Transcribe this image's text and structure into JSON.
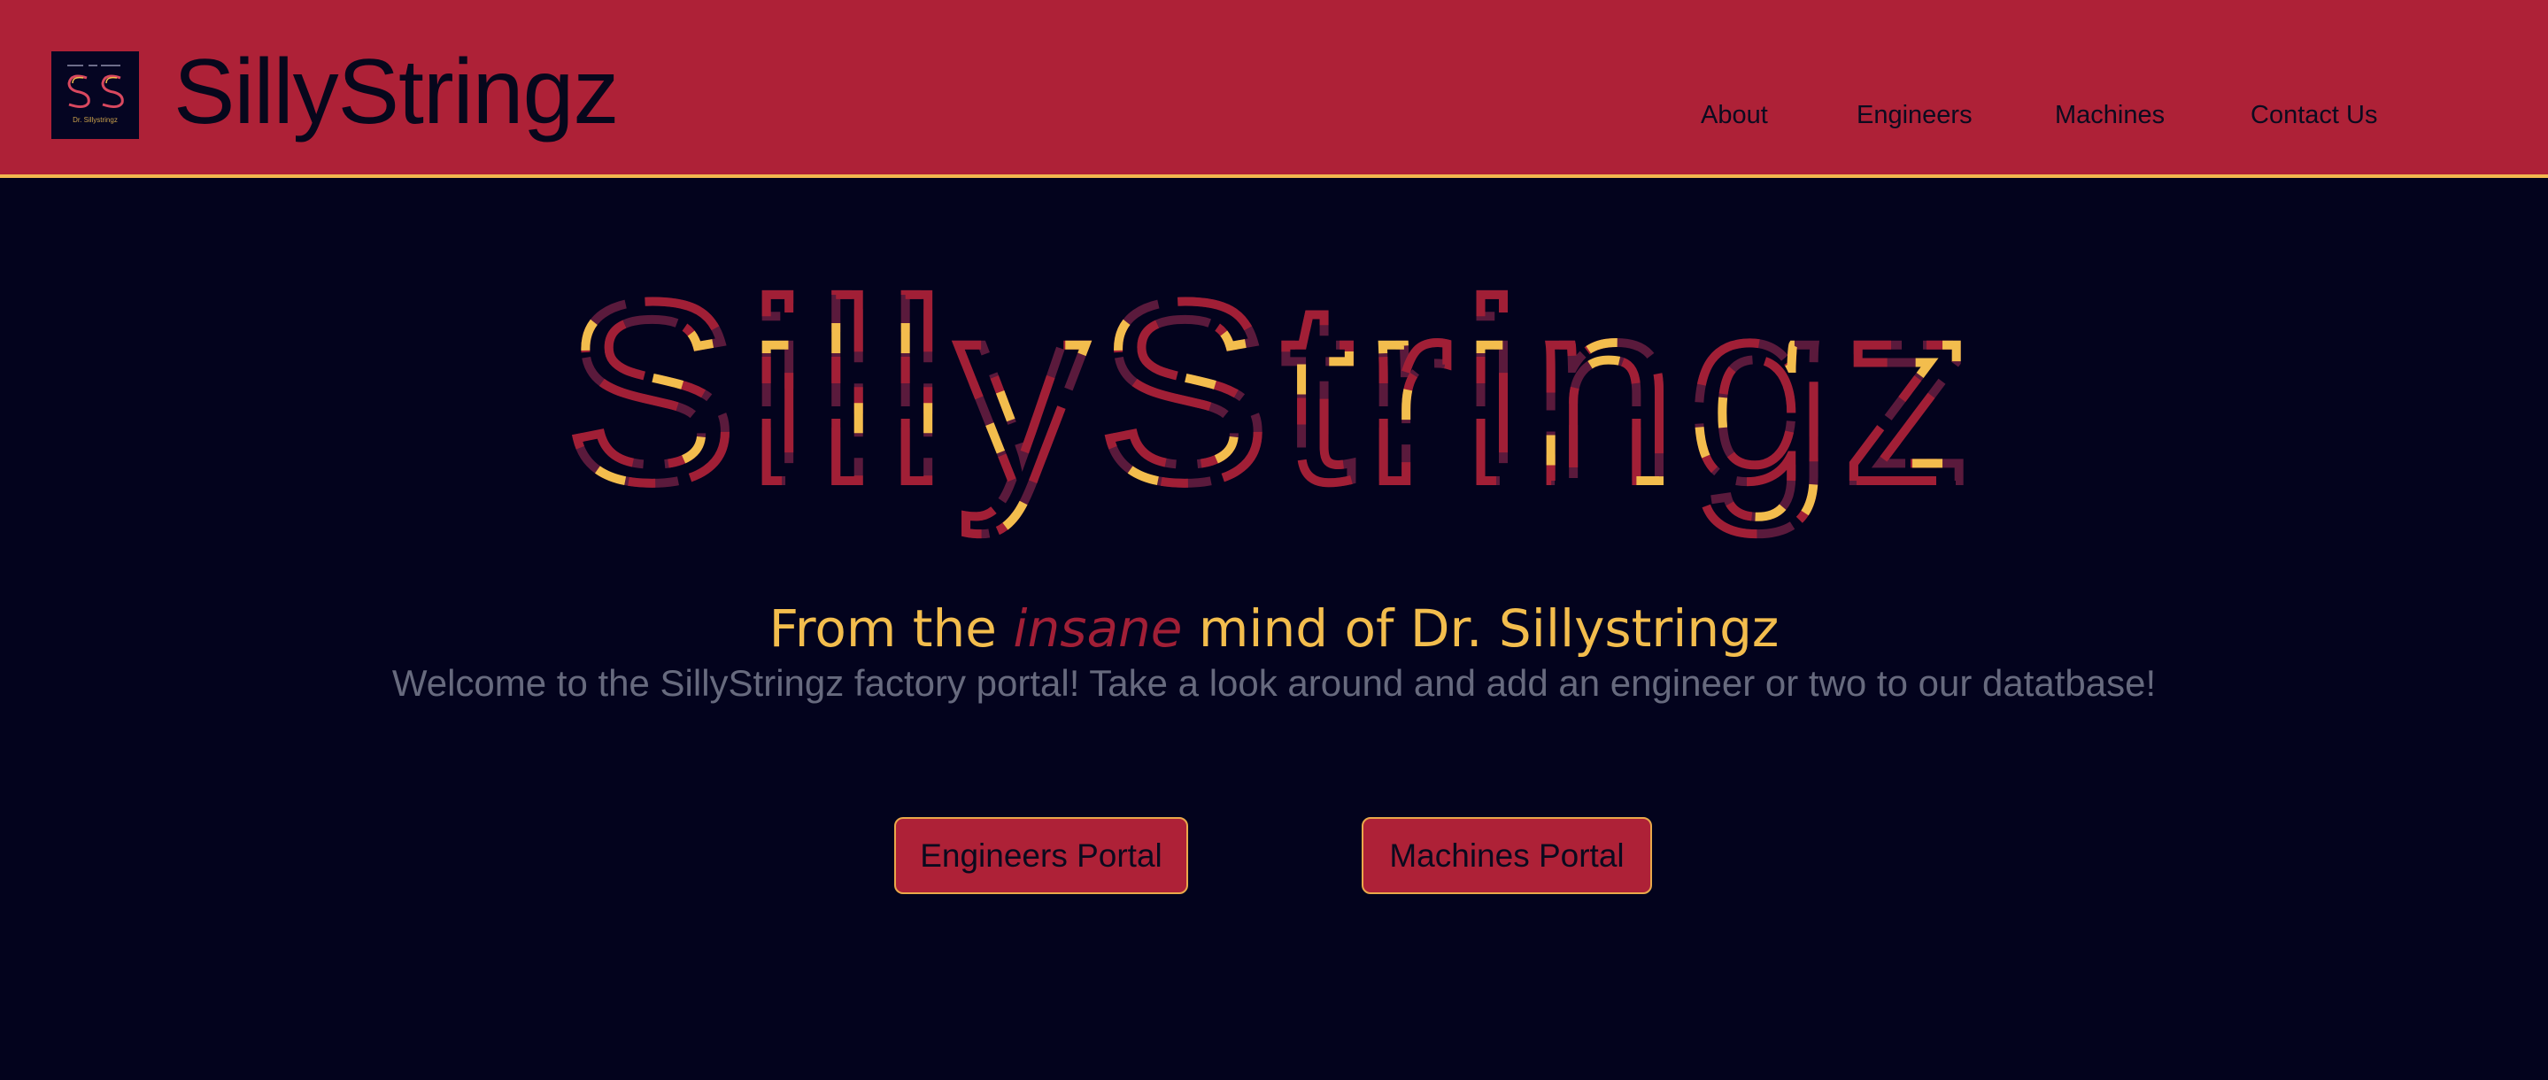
{
  "header": {
    "logo": {
      "icon": "ss-monogram-logo",
      "caption": "Dr. Sillystringz"
    },
    "brand_title": "SillyStringz",
    "nav": [
      {
        "label": "About"
      },
      {
        "label": "Engineers"
      },
      {
        "label": "Machines"
      },
      {
        "label": "Contact Us"
      }
    ]
  },
  "hero": {
    "art_text": "SillyStringz",
    "tagline": {
      "before": "From the",
      "emphasis": "insane",
      "after": "mind of Dr. Sillystringz"
    },
    "welcome": "Welcome to the SillyStringz factory portal! Take a look around and add an engineer or two to our datatbase!"
  },
  "actions": {
    "engineers_portal": "Engineers Portal",
    "machines_portal": "Machines Portal"
  },
  "colors": {
    "header_bg": "#ae2137",
    "page_bg": "#03031d",
    "accent_gold": "#f3bd4d",
    "accent_crimson": "#a11f36",
    "accent_plum": "#5a1a3c"
  }
}
